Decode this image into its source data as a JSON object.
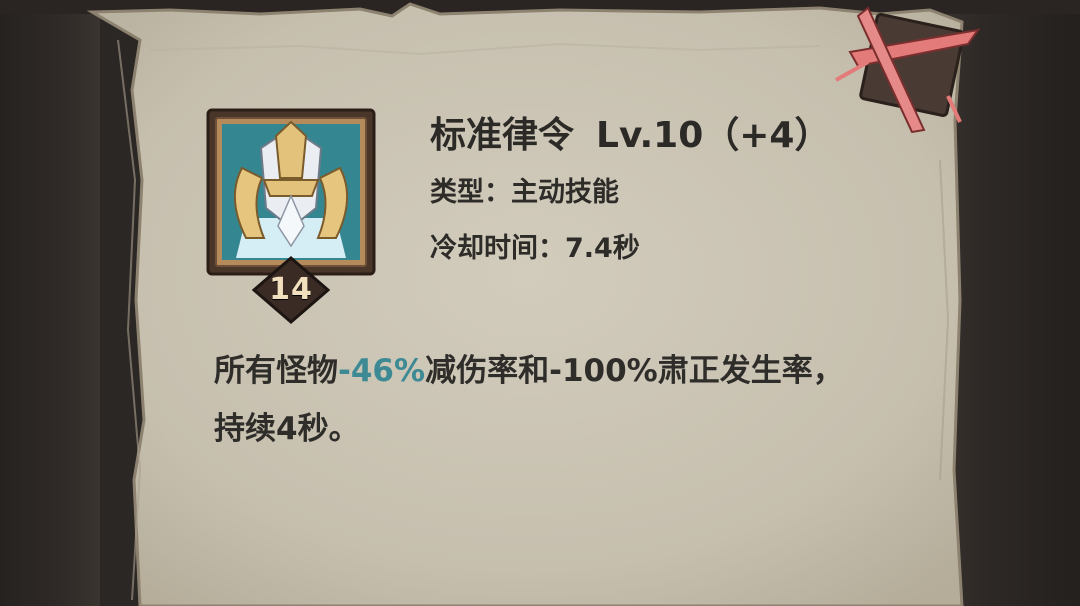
{
  "skill": {
    "name": "标准律令",
    "level_text": "Lv.10（+4）",
    "badge_number": "14",
    "type_label": "类型：",
    "type_value": "主动技能",
    "cooldown_label": "冷却时间：",
    "cooldown_value": "7.4秒"
  },
  "description": {
    "part1": "所有怪物",
    "highlight": "-46%",
    "part2": "减伤率和-100%肃正发生率，持续4秒。"
  },
  "colors": {
    "paper": "#cbc4b4",
    "text": "#2c2a27",
    "highlight": "#3d8a94",
    "close_accent": "#e07a78"
  },
  "icons": {
    "skill": "golden-helmet-emblem-icon",
    "close": "crossed-swords-close-icon"
  }
}
